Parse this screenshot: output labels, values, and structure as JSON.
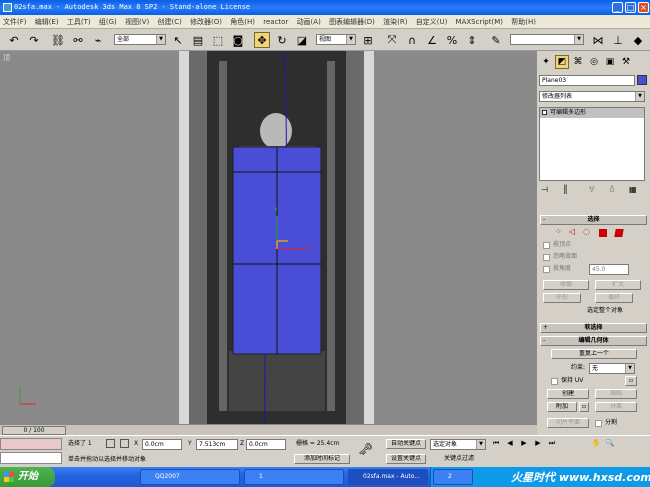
{
  "title": "02sfa.max - Autodesk 3ds Max 8 SP2 - Stand-alone License",
  "menus": [
    "文件(F)",
    "编辑(E)",
    "工具(T)",
    "组(G)",
    "视图(V)",
    "创建(C)",
    "修改器(O)",
    "角色(H)",
    "reactor",
    "动画(A)",
    "图表编辑器(D)",
    "渲染(R)",
    "自定义(U)",
    "MAXScript(M)",
    "帮助(H)"
  ],
  "toolbar": {
    "selection_filter": "全部",
    "ref_coord": "视图"
  },
  "viewport": {
    "label": "顶",
    "axis_y": "y",
    "axis_x": "x"
  },
  "command_panel": {
    "object_name": "Plane03",
    "modifier_list": "修改器列表",
    "stack_item": "可编辑多边形",
    "rollouts": {
      "selection": "选择",
      "by_vertex": "按顶点",
      "ignore_backfacing": "忽略背面",
      "by_angle": "按角度",
      "angle_value": "45.0",
      "shrink": "收缩",
      "grow": "扩大",
      "ring": "环形",
      "loop": "循环",
      "selected_info": "选定整个对象",
      "soft_selection": "软选择",
      "edit_geometry": "编辑几何体",
      "repeat_last": "重复上一个",
      "constraints_label": "约束:",
      "constraints_value": "无",
      "preserve_uv": "保持 UV",
      "create": "创建",
      "collapse": "塌陷",
      "attach": "附加",
      "detach": "分离",
      "slice_plane": "切片平面",
      "split": "分割"
    },
    "colors": {
      "object": "#4a4ed6"
    }
  },
  "timeline": {
    "frame": "0 / 100"
  },
  "status": {
    "selected": "选择了 1",
    "x_label": "X",
    "x_value": "0.0cm",
    "y_label": "Y",
    "y_value": "7.513cm",
    "z_label": "Z",
    "z_value": "0.0cm",
    "grid": "栅格 = 25.4cm",
    "prompt": "单击并拖动以选择并移动对象",
    "add_time_tag": "添加时间标记",
    "auto_key": "自动关键点",
    "set_key": "设置关键点",
    "selected_object": "选定对象",
    "key_filters": "关键点过滤"
  },
  "taskbar": {
    "start": "开始",
    "tasks": [
      "QQ2007",
      "1",
      "02sfa.max - Auto...",
      "2"
    ]
  },
  "watermark": "火星时代 www.hxsd.com"
}
